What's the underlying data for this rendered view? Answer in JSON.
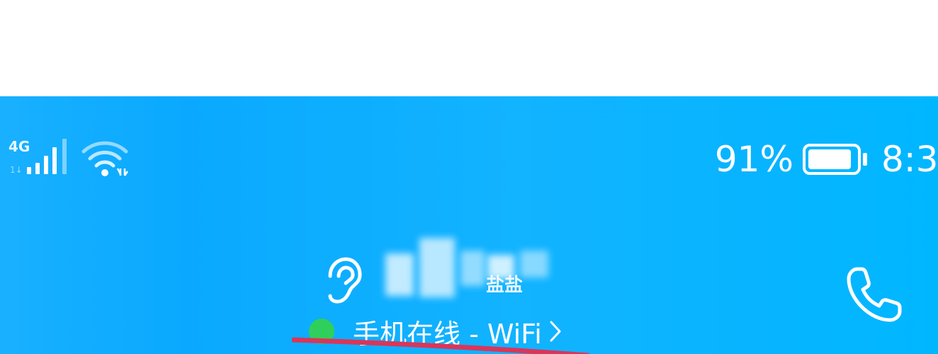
{
  "status_bar": {
    "network_type": "4G",
    "battery_percent": "91%",
    "battery_level": 0.91,
    "time": "8:3",
    "signal_icon": "cellular-signal-icon",
    "wifi_icon": "wifi-icon",
    "battery_icon": "battery-icon"
  },
  "contact": {
    "name_partial": "盐盐",
    "hearing_icon": "ear-icon",
    "online_status": "手机在线 - WiFi",
    "status_color": "#2fcf5b",
    "chevron_icon": "chevron-right-icon",
    "call_icon": "phone-icon"
  },
  "theme": {
    "header_color": "#0aa9ff",
    "annotation_color": "#d9365a"
  }
}
